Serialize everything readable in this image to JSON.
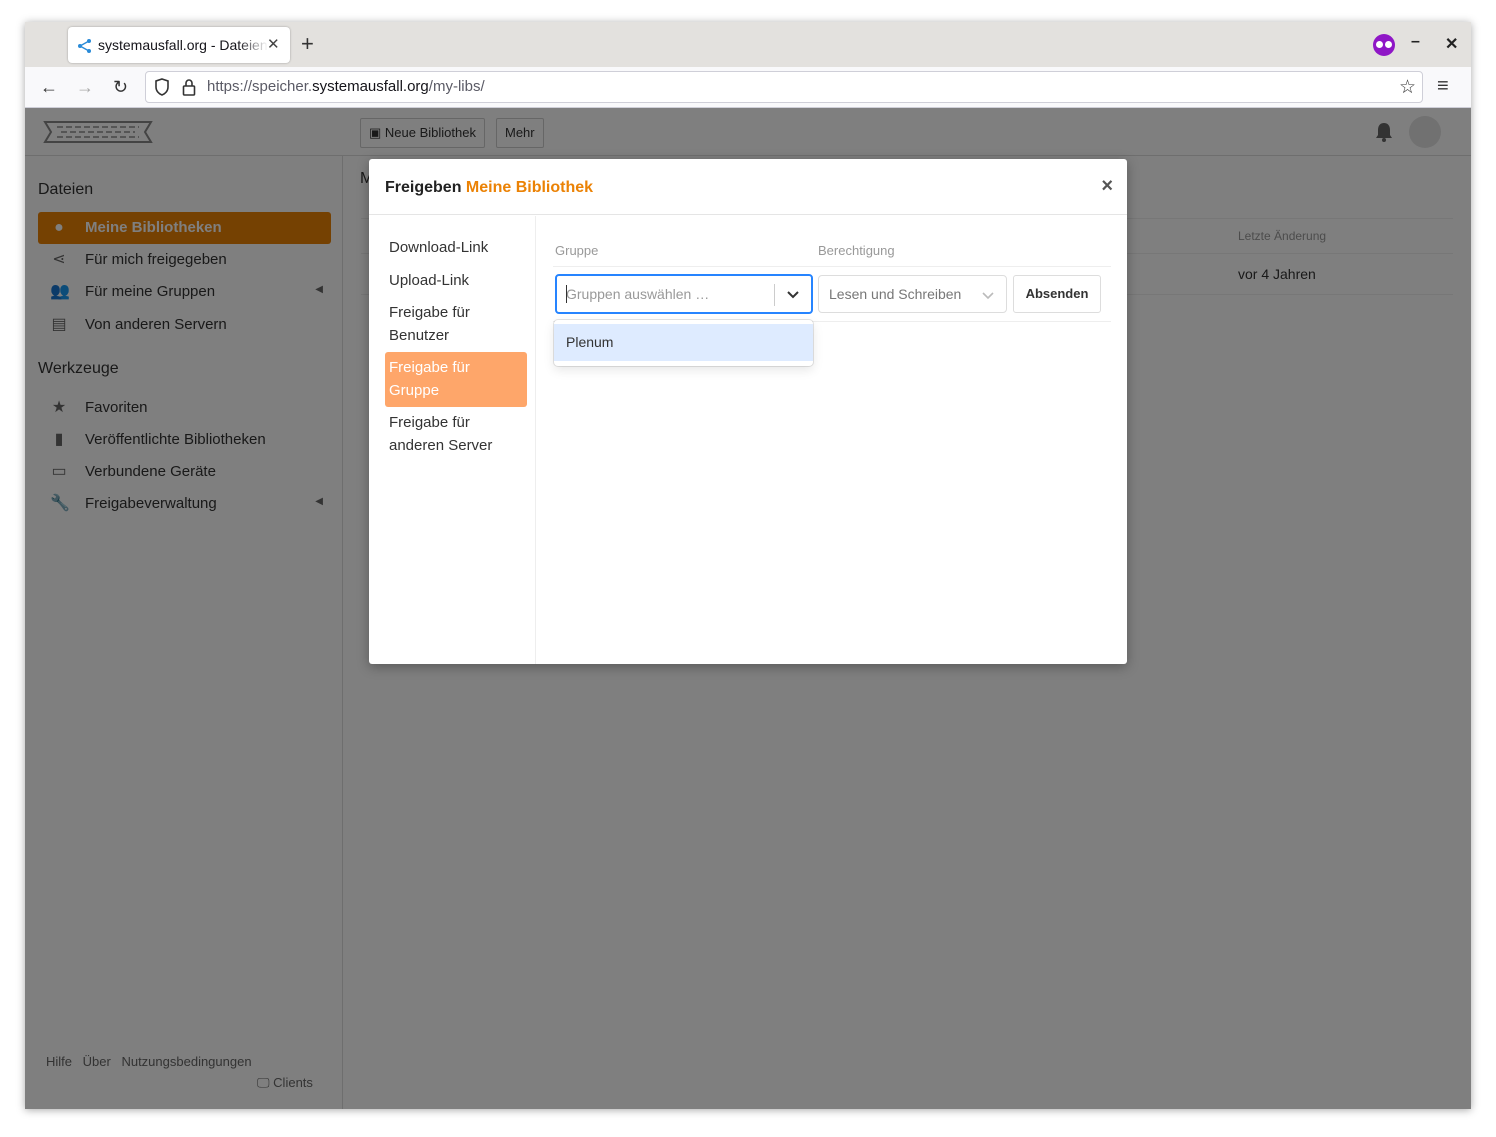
{
  "browser": {
    "tab_title": "systemausfall.org - Dateien",
    "url_prefix": "https://speicher.",
    "url_domain": "systemausfall.org",
    "url_path": "/my-libs/"
  },
  "topbar": {
    "new_library": "Neue Bibliothek",
    "more": "Mehr"
  },
  "sidebar": {
    "files_heading": "Dateien",
    "files_items": [
      {
        "label": "Meine Bibliotheken",
        "icon": "user-icon"
      },
      {
        "label": "Für mich freigegeben",
        "icon": "share-icon"
      },
      {
        "label": "Für meine Gruppen",
        "icon": "group-icon"
      },
      {
        "label": "Von anderen Servern",
        "icon": "server-icon"
      }
    ],
    "tools_heading": "Werkzeuge",
    "tools_items": [
      {
        "label": "Favoriten",
        "icon": "star-icon"
      },
      {
        "label": "Veröffentlichte Bibliotheken",
        "icon": "book-icon"
      },
      {
        "label": "Verbundene Geräte",
        "icon": "monitor-icon"
      },
      {
        "label": "Freigabeverwaltung",
        "icon": "wrench-icon"
      }
    ],
    "footer": {
      "help": "Hilfe",
      "about": "Über",
      "terms": "Nutzungsbedingungen",
      "clients": "Clients"
    }
  },
  "main": {
    "title_fragment": "M",
    "col_last_modified": "Letzte Änderung",
    "row_last_modified": "vor 4 Jahren"
  },
  "modal": {
    "title_prefix": "Freigeben",
    "title_library": "Meine Bibliothek",
    "close": "×",
    "nav": [
      {
        "label": "Download-Link"
      },
      {
        "label": "Upload-Link"
      },
      {
        "label": "Freigabe für Benutzer"
      },
      {
        "label": "Freigabe für Gruppe"
      },
      {
        "label": "Freigabe für anderen Server"
      }
    ],
    "active_nav_index": 3,
    "col_group": "Gruppe",
    "col_permission": "Berechtigung",
    "group_placeholder": "Gruppen auswählen …",
    "permission_value": "Lesen und Schreiben",
    "submit": "Absenden",
    "dropdown_options": [
      "Plenum"
    ]
  },
  "colors": {
    "accent": "#eb8205",
    "active_nav": "#fea66a",
    "focus": "#2684ff",
    "option_highlight": "#deebff"
  }
}
